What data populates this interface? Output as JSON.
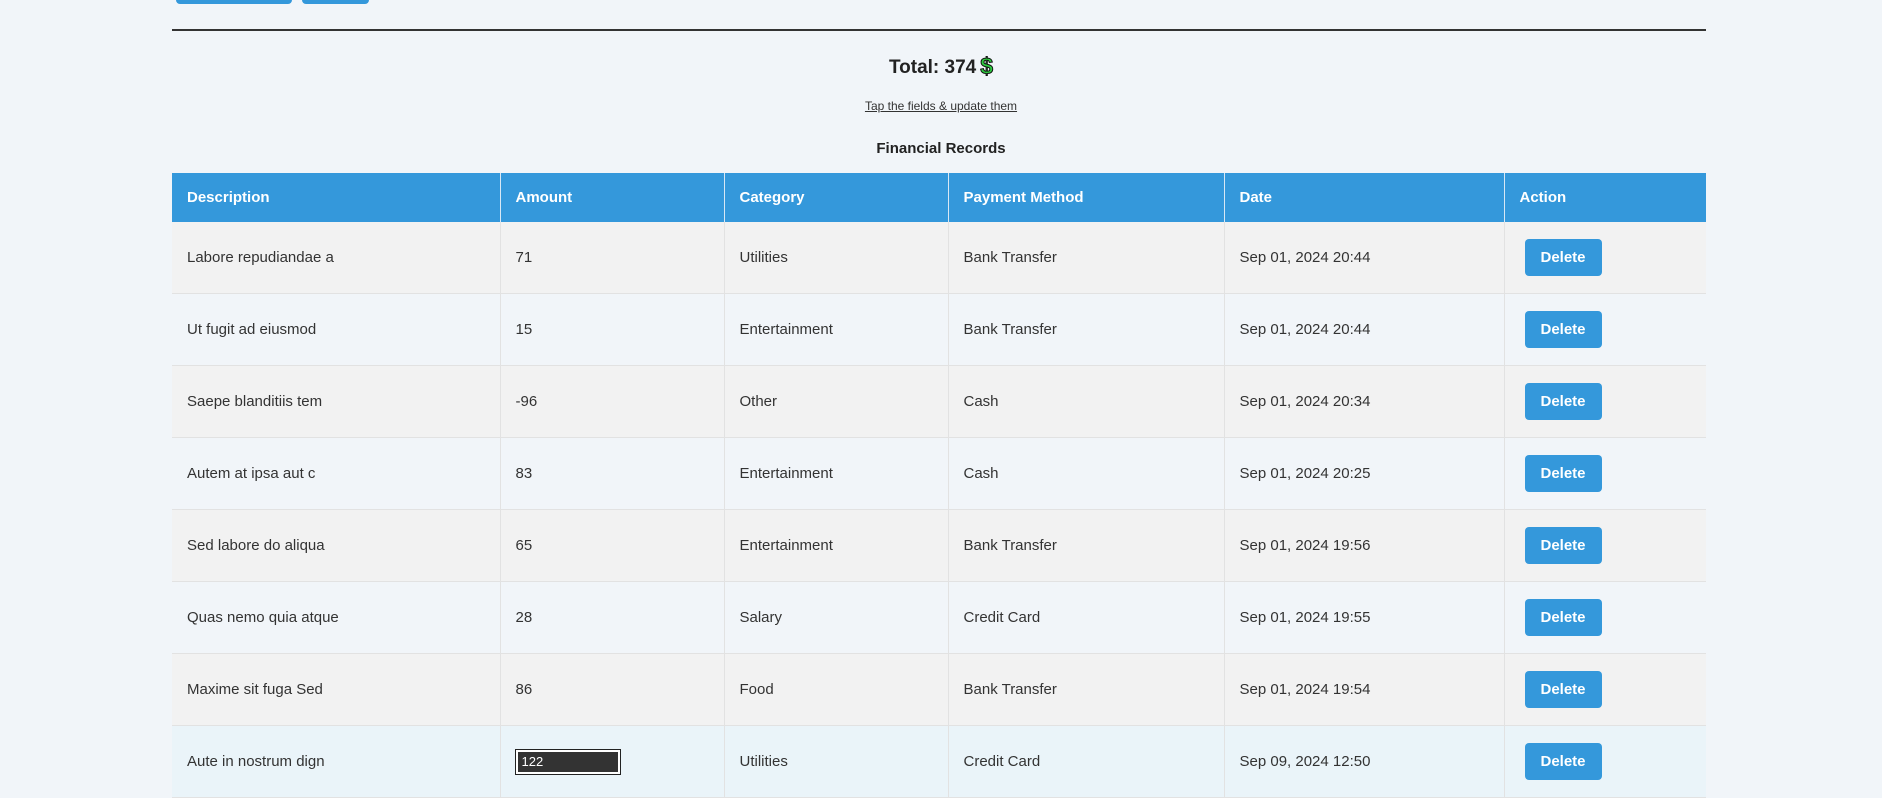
{
  "total": {
    "label": "Total: 374",
    "icon": "dollar-icon",
    "icon_glyph": "$",
    "icon_color": "#2ecc40"
  },
  "hint": "Tap the fields & update them",
  "table_title": "Financial Records",
  "colors": {
    "accent": "#3498db",
    "background": "#f1f5f9"
  },
  "columns": [
    "Description",
    "Amount",
    "Category",
    "Payment Method",
    "Date",
    "Action"
  ],
  "rows": [
    {
      "description": "Labore repudiandae a",
      "amount": "71",
      "category": "Utilities",
      "payment_method": "Bank Transfer",
      "date": "Sep 01, 2024 20:44",
      "action": "Delete"
    },
    {
      "description": "Ut fugit ad eiusmod",
      "amount": "15",
      "category": "Entertainment",
      "payment_method": "Bank Transfer",
      "date": "Sep 01, 2024 20:44",
      "action": "Delete"
    },
    {
      "description": "Saepe blanditiis tem",
      "amount": "-96",
      "category": "Other",
      "payment_method": "Cash",
      "date": "Sep 01, 2024 20:34",
      "action": "Delete"
    },
    {
      "description": "Autem at ipsa aut c",
      "amount": "83",
      "category": "Entertainment",
      "payment_method": "Cash",
      "date": "Sep 01, 2024 20:25",
      "action": "Delete"
    },
    {
      "description": "Sed labore do aliqua",
      "amount": "65",
      "category": "Entertainment",
      "payment_method": "Bank Transfer",
      "date": "Sep 01, 2024 19:56",
      "action": "Delete"
    },
    {
      "description": "Quas nemo quia atque",
      "amount": "28",
      "category": "Salary",
      "payment_method": "Credit Card",
      "date": "Sep 01, 2024 19:55",
      "action": "Delete"
    },
    {
      "description": "Maxime sit fuga Sed",
      "amount": "86",
      "category": "Food",
      "payment_method": "Bank Transfer",
      "date": "Sep 01, 2024 19:54",
      "action": "Delete"
    }
  ],
  "editing_row": {
    "description": "Aute in nostrum dign",
    "amount_value": "122",
    "category": "Utilities",
    "payment_method": "Credit Card",
    "date": "Sep 09, 2024 12:50",
    "action": "Delete"
  }
}
